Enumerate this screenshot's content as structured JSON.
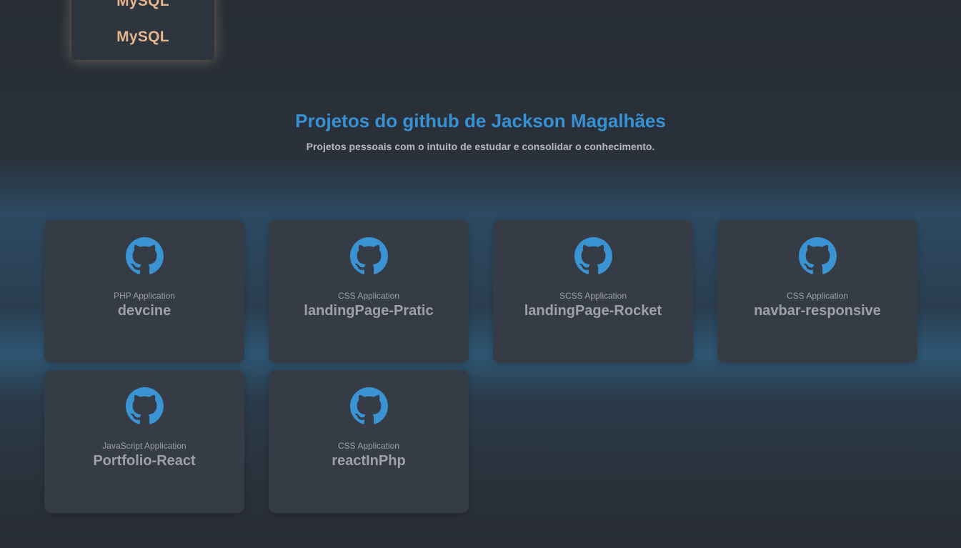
{
  "skills": {
    "items": [
      "MySQL",
      "MySQL"
    ],
    "accent_color": "#e3b48d"
  },
  "section": {
    "title": "Projetos do github de Jackson Magalhães",
    "subtitle": "Projetos pessoais com o intuito de estudar e consolidar o conhecimento."
  },
  "projects": [
    {
      "language": "PHP Application",
      "name": "devcine",
      "icon": "github-icon"
    },
    {
      "language": "CSS Application",
      "name": "landingPage-Pratic",
      "icon": "github-icon"
    },
    {
      "language": "SCSS Application",
      "name": "landingPage-Rocket",
      "icon": "github-icon"
    },
    {
      "language": "CSS Application",
      "name": "navbar-responsive",
      "icon": "github-icon"
    },
    {
      "language": "JavaScript Application",
      "name": "Portfolio-React",
      "icon": "github-icon"
    },
    {
      "language": "CSS Application",
      "name": "reactInPhp",
      "icon": "github-icon"
    }
  ],
  "colors": {
    "title": "#3791d2",
    "icon": "#3a93d3",
    "card": "#353c45"
  }
}
